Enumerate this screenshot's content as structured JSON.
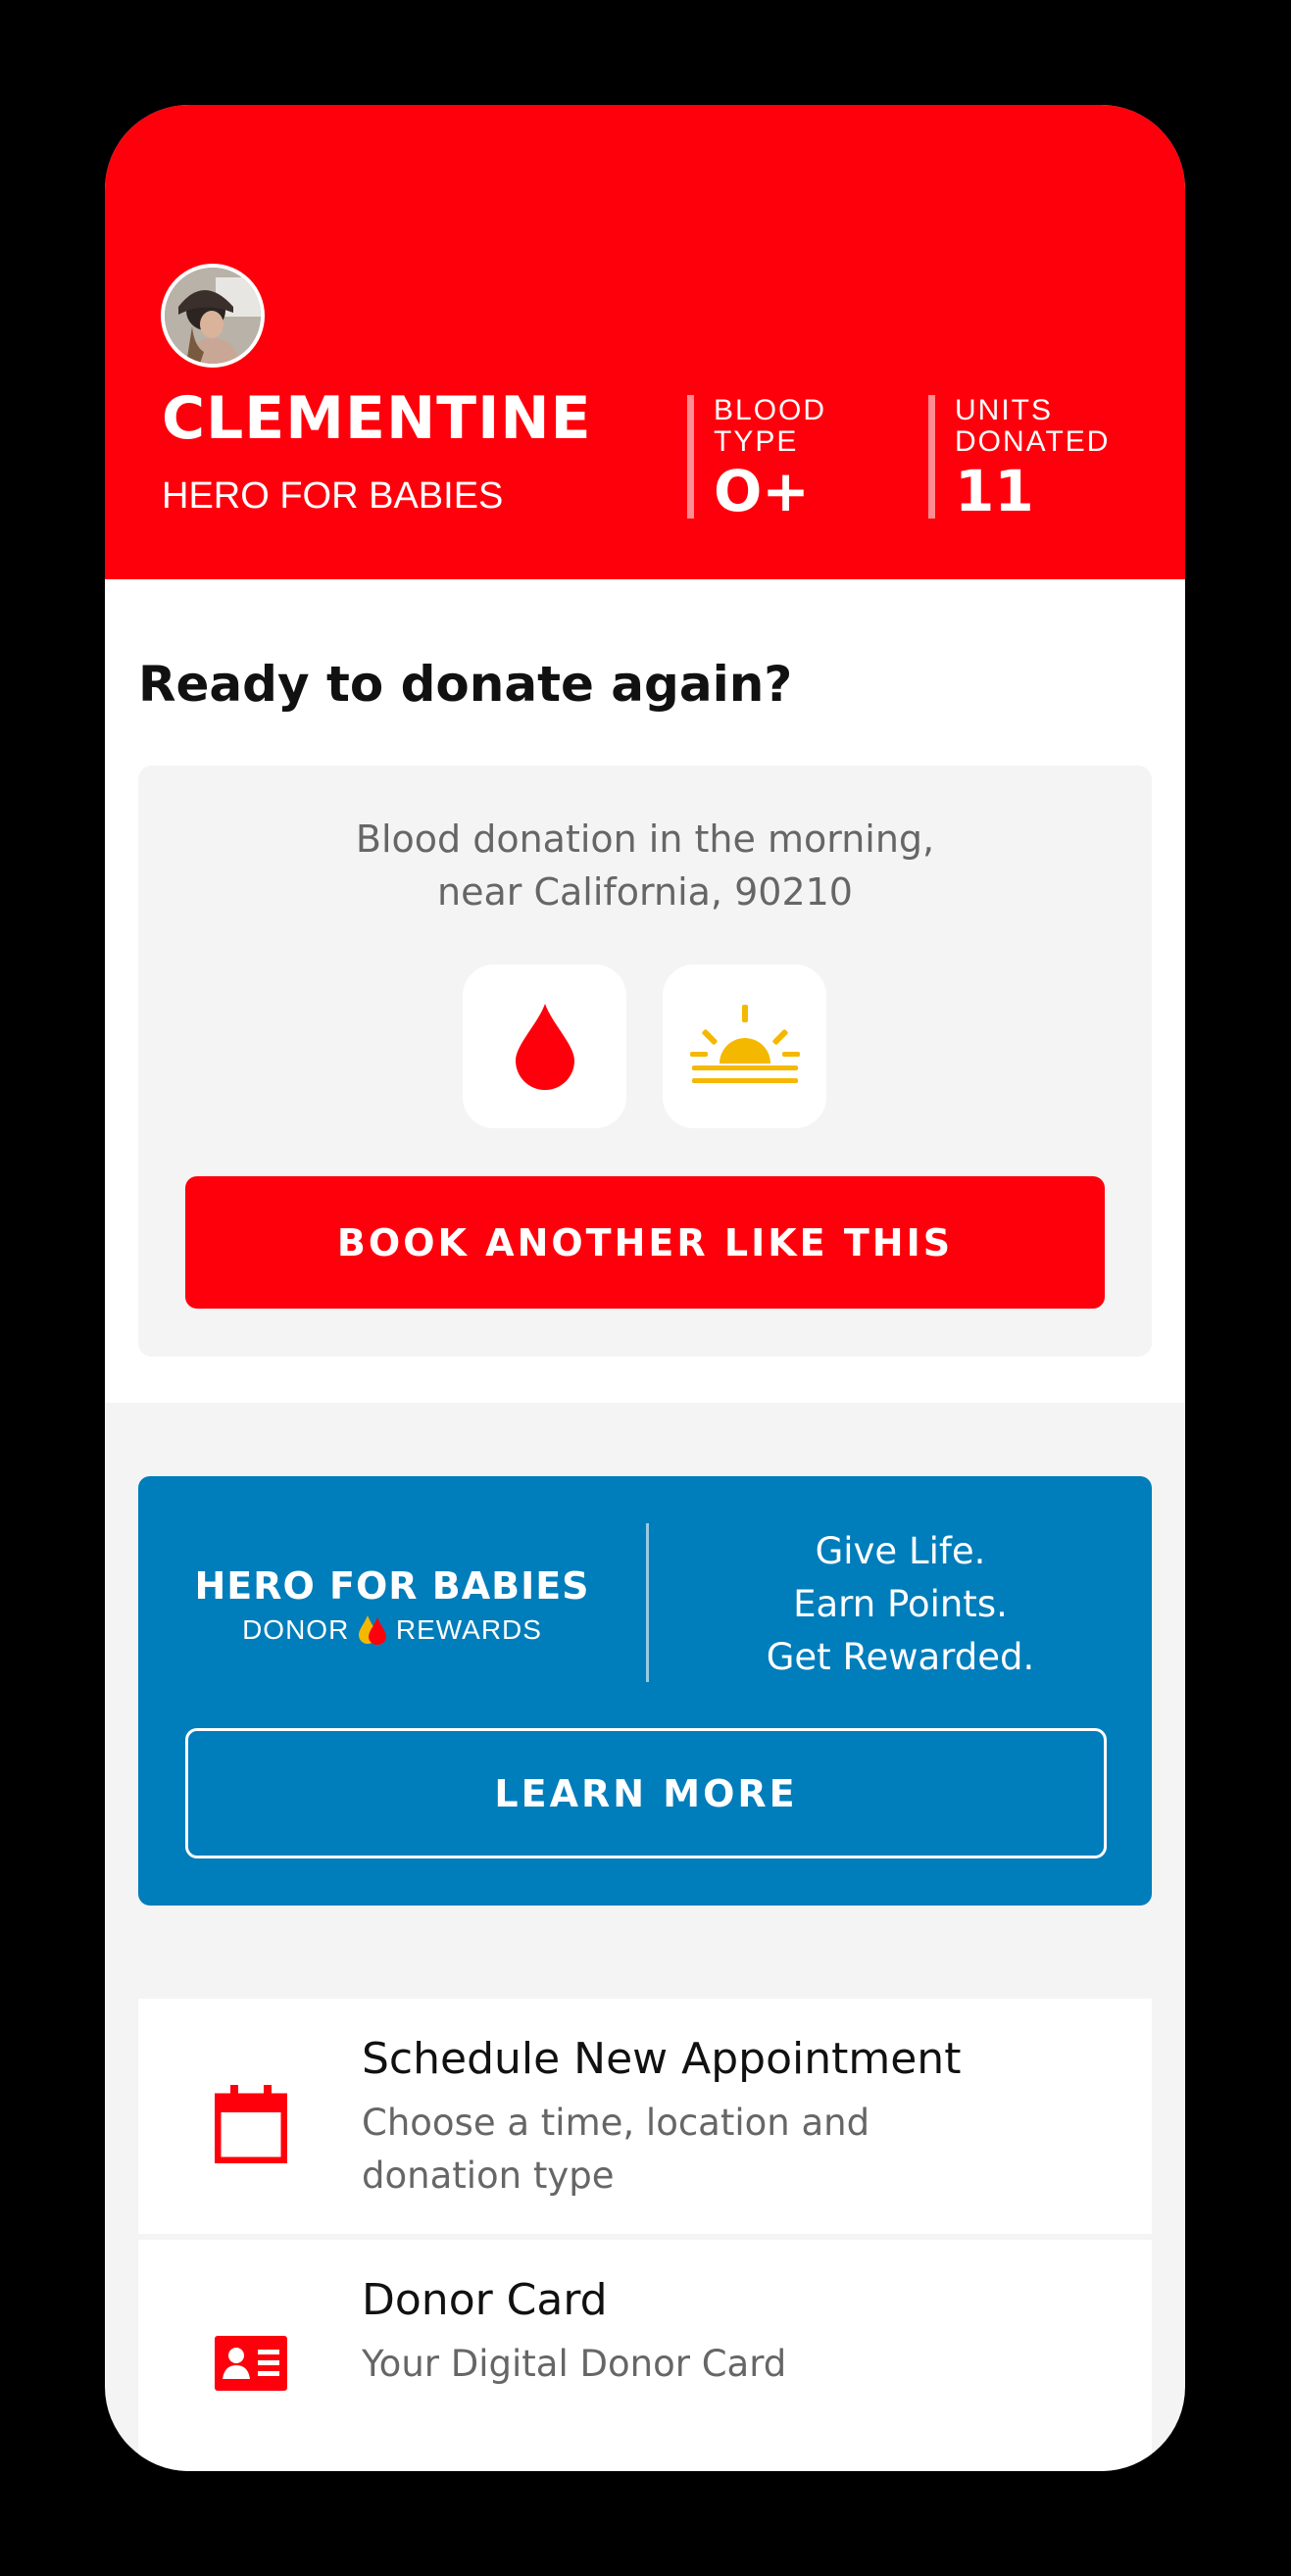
{
  "profile": {
    "name": "CLEMENTINE",
    "title": "HERO FOR BABIES",
    "blood_type_label": "BLOOD TYPE",
    "blood_type": "O+",
    "units_label": "UNITS DONATED",
    "units": "11"
  },
  "ready": {
    "heading": "Ready to donate again?",
    "suggestion_line1": "Blood donation in the morning,",
    "suggestion_line2": "near California, 90210",
    "book_button": "BOOK ANOTHER LIKE THIS"
  },
  "rewards": {
    "brand": "HERO FOR BABIES",
    "brand_sub_left": "DONOR",
    "brand_sub_right": "REWARDS",
    "tagline1": "Give Life.",
    "tagline2": "Earn Points.",
    "tagline3": "Get Rewarded.",
    "learn_button": "LEARN MORE"
  },
  "menu": {
    "schedule_title": "Schedule New Appointment",
    "schedule_sub_line1": "Choose a time, location and",
    "schedule_sub_line2": "donation type",
    "card_title": "Donor Card",
    "card_sub": "Your Digital Donor Card"
  },
  "colors": {
    "brand_red": "#fe000b",
    "rewards_blue": "#007dbb",
    "sun_yellow": "#f5b800"
  },
  "icons": [
    "avatar-photo",
    "blood-drop-icon",
    "sunrise-icon",
    "calendar-icon",
    "id-card-icon"
  ]
}
